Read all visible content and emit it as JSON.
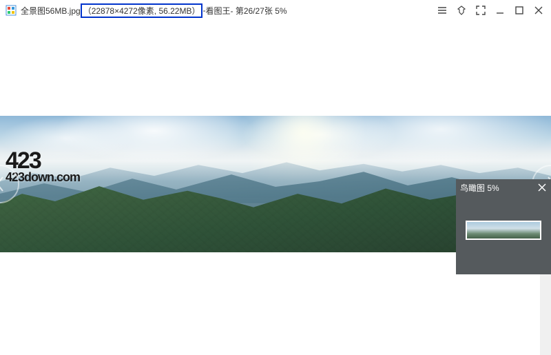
{
  "title": {
    "filename": "全景图56MB.jpg",
    "details": "（22878×4272像素, 56.22MB）",
    "app_sep": "- ",
    "app_name": "看图王",
    "position": " - 第26/27张 5%"
  },
  "watermark": {
    "top": "423       ",
    "bottom": "423down.com",
    "accent": "DOWN"
  },
  "thumb": {
    "title": "鸟瞰图 5%"
  }
}
